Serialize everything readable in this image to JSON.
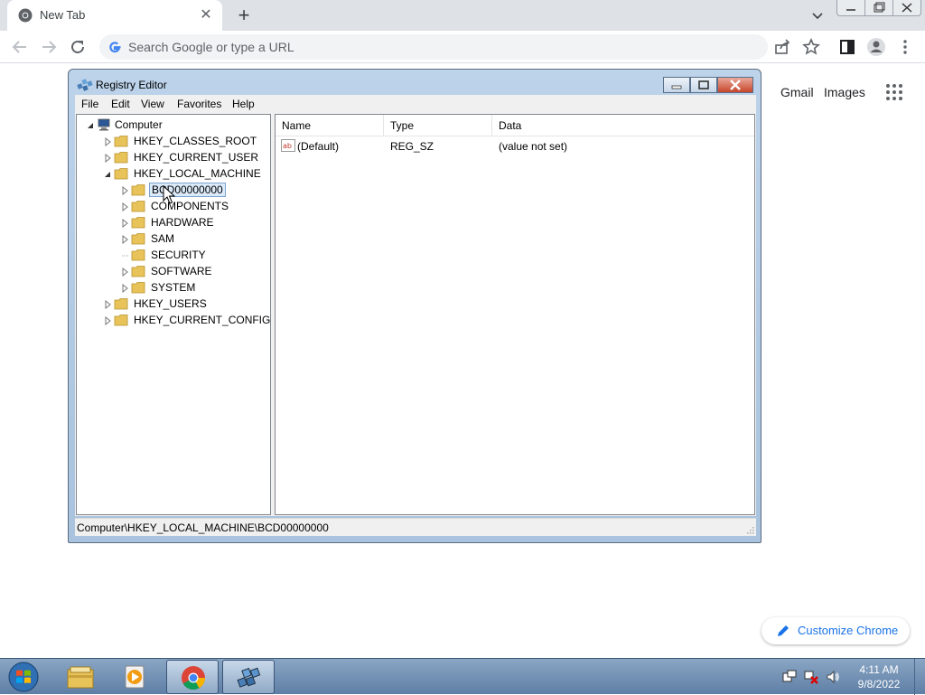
{
  "browser": {
    "tab_title": "New Tab",
    "omnibox_placeholder": "Search Google or type a URL",
    "ntp_links": {
      "gmail": "Gmail",
      "images": "Images"
    },
    "customize_label": "Customize Chrome"
  },
  "regedit": {
    "title": "Registry Editor",
    "menu": [
      "File",
      "Edit",
      "View",
      "Favorites",
      "Help"
    ],
    "tree": {
      "root": "Computer",
      "hives": [
        "HKEY_CLASSES_ROOT",
        "HKEY_CURRENT_USER",
        "HKEY_LOCAL_MACHINE",
        "HKEY_USERS",
        "HKEY_CURRENT_CONFIG"
      ],
      "local_machine_children": [
        "BCD00000000",
        "COMPONENTS",
        "HARDWARE",
        "SAM",
        "SECURITY",
        "SOFTWARE",
        "SYSTEM"
      ],
      "selected": "BCD00000000"
    },
    "columns": [
      "Name",
      "Type",
      "Data"
    ],
    "values": [
      {
        "name": "(Default)",
        "type": "REG_SZ",
        "data": "(value not set)"
      }
    ],
    "status_path": "Computer\\HKEY_LOCAL_MACHINE\\BCD00000000"
  },
  "taskbar": {
    "time": "4:11 AM",
    "date": "9/8/2022"
  },
  "colors": {
    "chrome_frame": "#dee1e6",
    "accent_blue": "#1a73e8",
    "selection": "#dbeaf9",
    "folder_yellow": "#e8c35a"
  }
}
